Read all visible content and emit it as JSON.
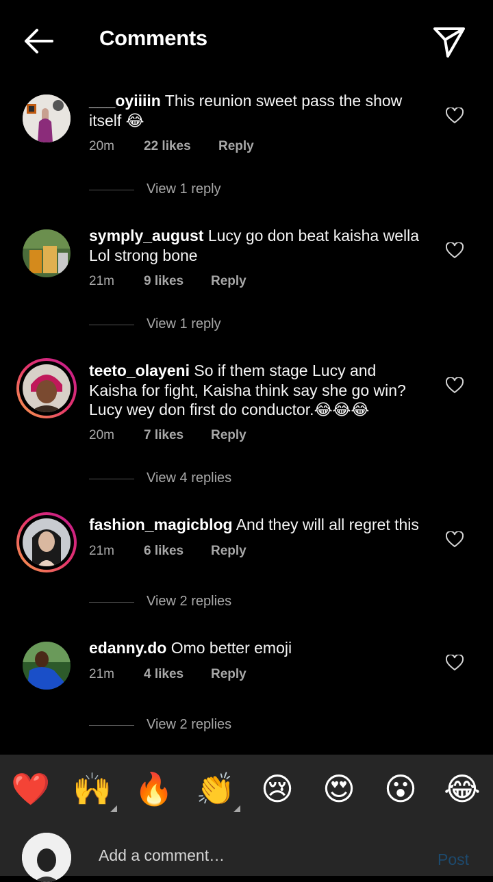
{
  "header": {
    "title": "Comments"
  },
  "comments": [
    {
      "username": "___oyiiiin",
      "text": " This reunion sweet pass the show itself 😂",
      "time": "20m",
      "likes": "22 likes",
      "reply": "Reply",
      "view_replies": "View 1 reply"
    },
    {
      "username": "symply_august",
      "text": " Lucy go don beat kaisha wella Lol strong bone",
      "time": "21m",
      "likes": "9 likes",
      "reply": "Reply",
      "view_replies": "View 1 reply"
    },
    {
      "username": "teeto_olayeni",
      "text": " So if them stage Lucy and Kaisha for fight, Kaisha think say she go win? Lucy wey don first do conductor.😂😂😂",
      "time": "20m",
      "likes": "7 likes",
      "reply": "Reply",
      "view_replies": "View 4 replies"
    },
    {
      "username": "fashion_magicblog",
      "text": " And they will all regret this",
      "time": "21m",
      "likes": "6 likes",
      "reply": "Reply",
      "view_replies": "View 2 replies"
    },
    {
      "username": "edanny.do",
      "text": " Omo better emoji",
      "time": "21m",
      "likes": "4 likes",
      "reply": "Reply",
      "view_replies": "View 2 replies"
    }
  ],
  "emoji_bar": {
    "emojis": [
      "❤️",
      "🙌",
      "🔥",
      "👏",
      "😢",
      "😍",
      "😮",
      "😂"
    ]
  },
  "compose": {
    "placeholder": "Add a comment…",
    "post_label": "Post"
  },
  "colors": {
    "background": "#000000",
    "secondary_text": "#a8a8a8",
    "bar_background": "#262626",
    "post_disabled": "#1d4a6e"
  }
}
